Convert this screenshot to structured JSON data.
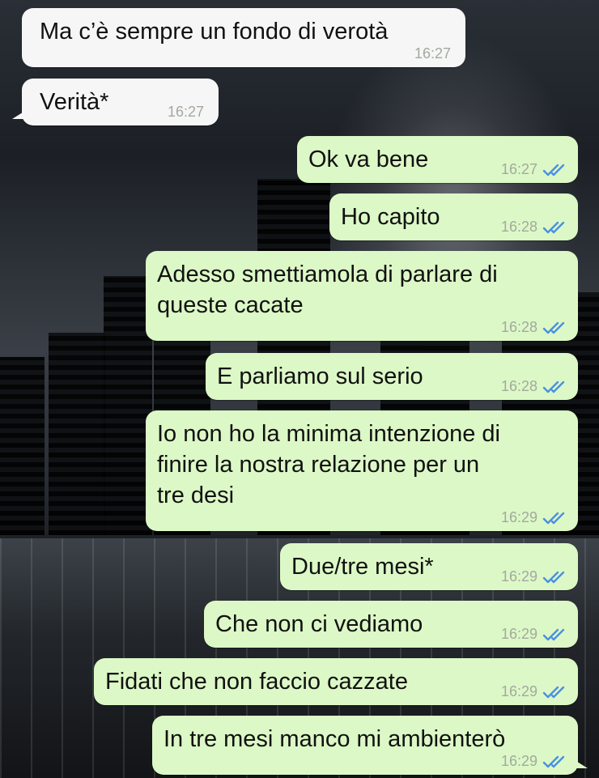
{
  "messages": [
    {
      "direction": "in",
      "text_lines": [
        "Ma c’è sempre un fondo di verotà"
      ],
      "time": "16:27"
    },
    {
      "direction": "in",
      "text_lines": [
        "Verità*"
      ],
      "time": "16:27"
    },
    {
      "direction": "out",
      "text_lines": [
        "Ok va bene"
      ],
      "time": "16:27",
      "status": "read-double-check"
    },
    {
      "direction": "out",
      "text_lines": [
        "Ho capito"
      ],
      "time": "16:28",
      "status": "read-double-check"
    },
    {
      "direction": "out",
      "text_lines": [
        "Adesso smettiamola di parlare di",
        "queste cacate"
      ],
      "time": "16:28",
      "status": "read-double-check"
    },
    {
      "direction": "out",
      "text_lines": [
        "E parliamo sul serio"
      ],
      "time": "16:28",
      "status": "read-double-check"
    },
    {
      "direction": "out",
      "text_lines": [
        "Io non ho la minima intenzione di",
        "finire la nostra relazione per un",
        "tre desi"
      ],
      "time": "16:29",
      "status": "read-double-check"
    },
    {
      "direction": "out",
      "text_lines": [
        "Due/tre mesi*"
      ],
      "time": "16:29",
      "status": "read-double-check"
    },
    {
      "direction": "out",
      "text_lines": [
        "Che non ci vediamo"
      ],
      "time": "16:29",
      "status": "read-double-check"
    },
    {
      "direction": "out",
      "text_lines": [
        "Fidati che non faccio cazzate"
      ],
      "time": "16:29",
      "status": "read-double-check"
    },
    {
      "direction": "out",
      "text_lines": [
        "In tre mesi manco mi ambienterò"
      ],
      "time": "16:29",
      "status": "read-double-check"
    }
  ],
  "colors": {
    "incoming_bubble": "#f6f6f6",
    "outgoing_bubble": "#dcf8c6",
    "read_ticks": "#4a90e2",
    "timestamp": "#a3a9a0"
  },
  "icons": {
    "read_receipt": "double-check-icon"
  }
}
